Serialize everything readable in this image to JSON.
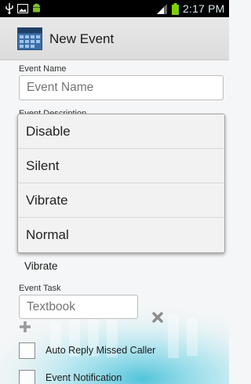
{
  "status_bar": {
    "time": "2:17 PM",
    "icons": [
      "usb-icon",
      "picture-icon",
      "android-icon",
      "signal-icon",
      "battery-icon"
    ],
    "battery_color": "#7fd100"
  },
  "action_bar": {
    "title": "New Event",
    "icon": "calendar-icon"
  },
  "form": {
    "event_name_label": "Event Name",
    "event_name_placeholder": "Event Name",
    "event_description_label": "Event Description",
    "ring_mode_value": "Vibrate",
    "event_task_label": "Event Task",
    "event_task_placeholder": "Textbook",
    "delete_task_icon": "close-icon",
    "add_task_icon": "plus-icon"
  },
  "dropdown": {
    "options": [
      "Disable",
      "Silent",
      "Vibrate",
      "Normal"
    ]
  },
  "checkboxes": [
    {
      "label": "Auto Reply Missed Caller",
      "checked": false
    },
    {
      "label": "Event Notification",
      "checked": false
    }
  ],
  "colors": {
    "accent_teal": "#4fc3d6",
    "status_bar": "#000000"
  }
}
